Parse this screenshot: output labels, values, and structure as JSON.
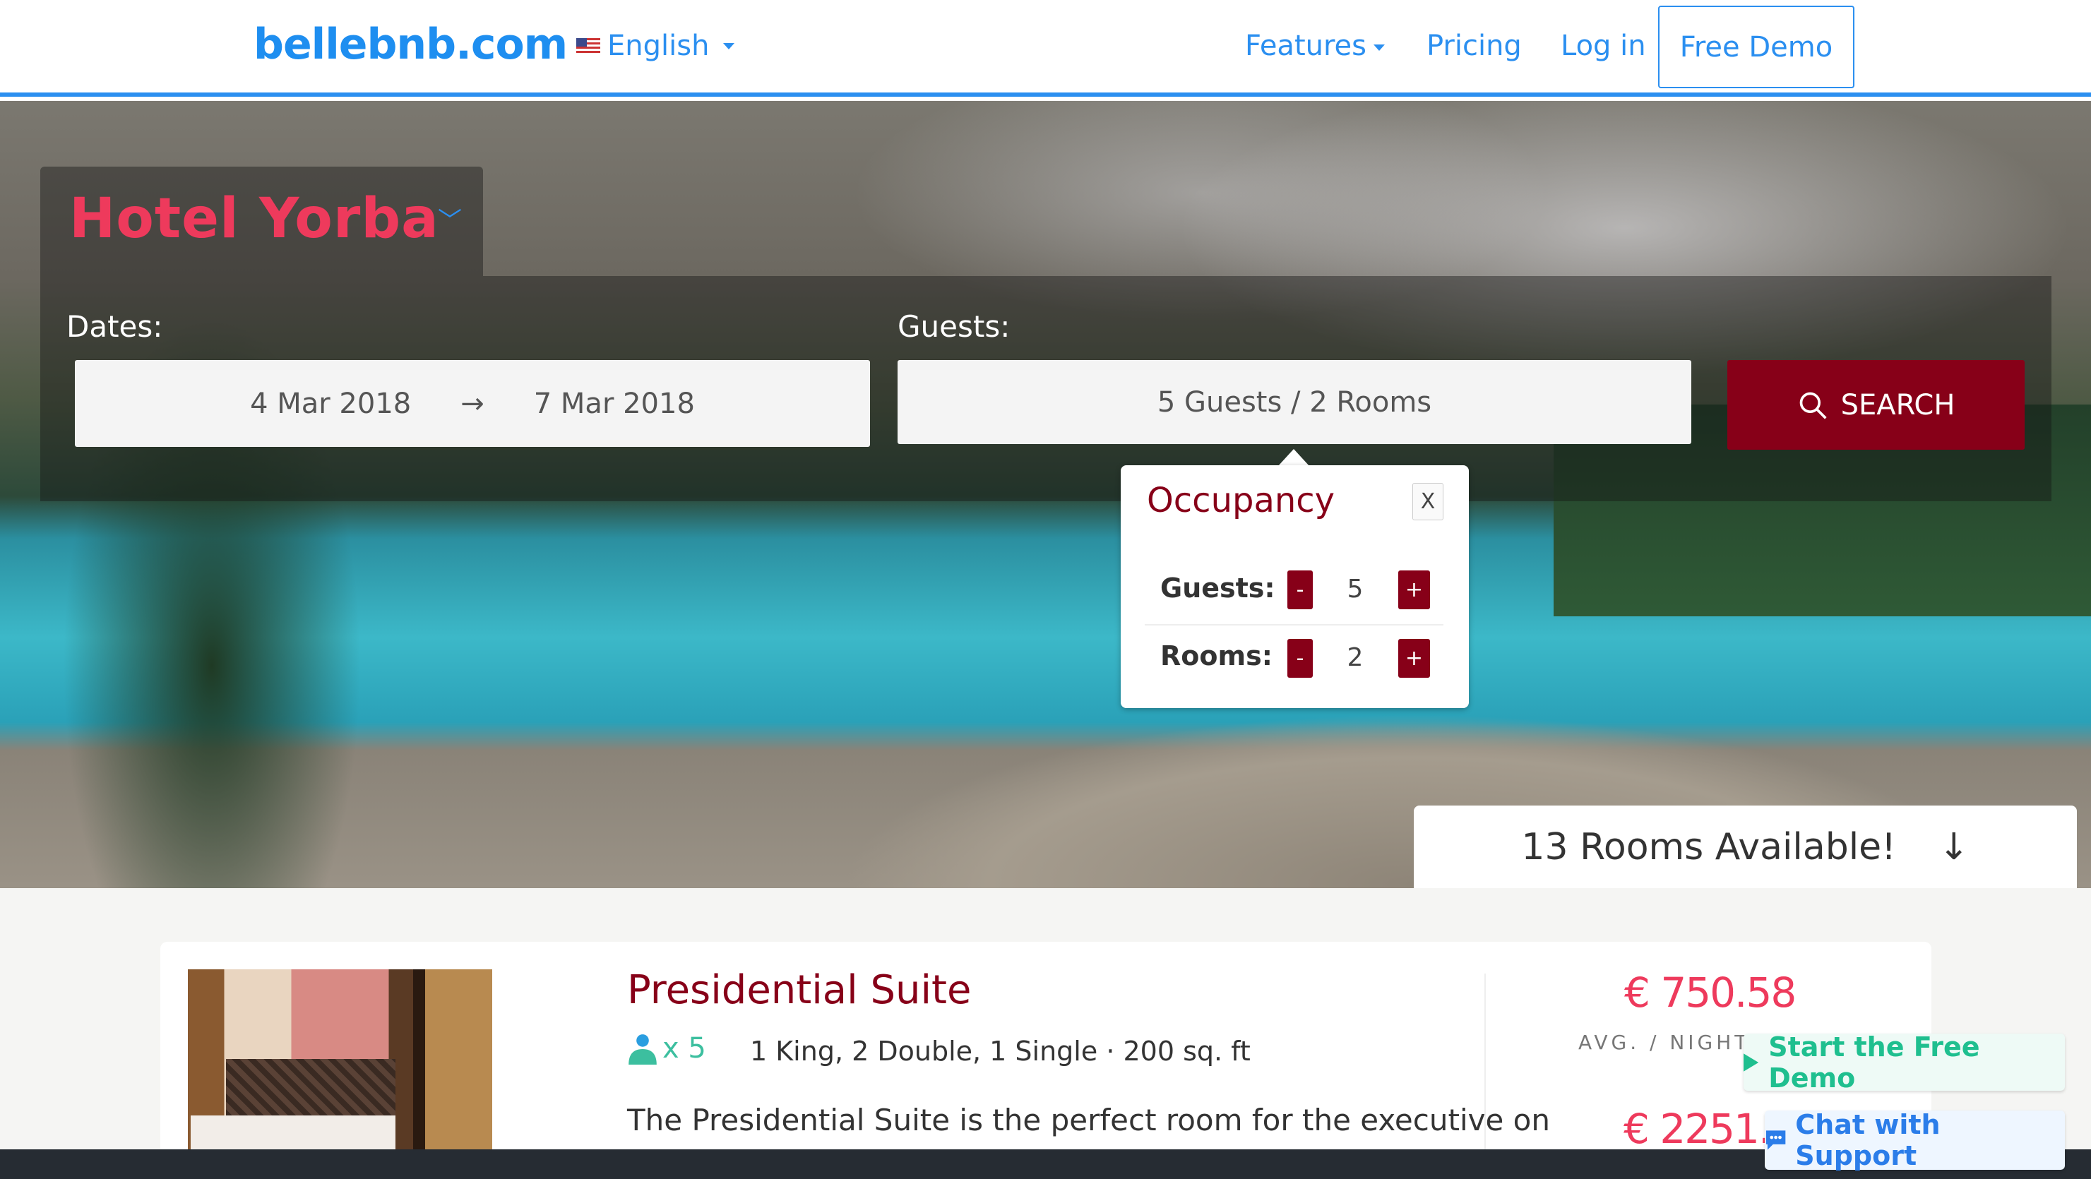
{
  "nav": {
    "logo": "bellebnb.com",
    "language": "English",
    "features": "Features",
    "pricing": "Pricing",
    "login": "Log in",
    "free_demo": "Free Demo"
  },
  "hotel": {
    "name": "Hotel Yorba"
  },
  "search": {
    "dates_label": "Dates:",
    "check_in": "4 Mar 2018",
    "arrow": "→",
    "check_out": "7 Mar 2018",
    "guests_label": "Guests:",
    "guests_value": "5 Guests / 2 Rooms",
    "button": "SEARCH"
  },
  "occupancy": {
    "title": "Occupancy",
    "close": "X",
    "guests_label": "Guests:",
    "guests": "5",
    "rooms_label": "Rooms:",
    "rooms": "2",
    "minus": "-",
    "plus": "+"
  },
  "availability": {
    "text": "13 Rooms Available!",
    "arrow": "↓"
  },
  "room": {
    "title": "Presidential Suite",
    "occupancy": "x 5",
    "details": "1 King, 2 Double, 1 Single · 200 sq. ft",
    "description": "The Presidential Suite is the perfect room for the executive on",
    "price_avg": "€ 750.58",
    "avg_label": "AVG. / NIGHT (",
    "price_total": "€ 2251.7"
  },
  "widgets": {
    "start_demo": "Start the Free Demo",
    "chat": "Chat with Support"
  },
  "colors": {
    "brand_blue": "#2b8ff0",
    "accent_red": "#870018",
    "price_pink": "#ee3a5c",
    "teal": "#3cbf9f"
  }
}
